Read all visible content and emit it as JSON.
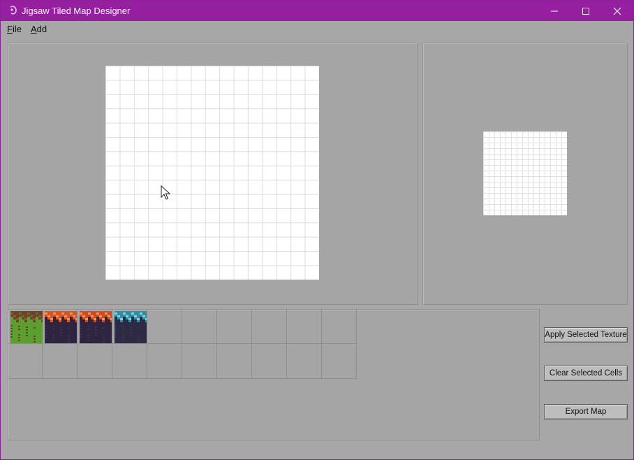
{
  "window": {
    "title": "Jigsaw Tiled Map Designer",
    "controls": {
      "minimize": "—",
      "maximize": "☐",
      "close": "✕"
    }
  },
  "menu": {
    "file": {
      "mnemonic": "F",
      "rest": "ile"
    },
    "add": {
      "mnemonic": "A",
      "rest": "dd"
    }
  },
  "map_editor": {
    "rows": 15,
    "cols": 15
  },
  "preview": {
    "rows": 15,
    "cols": 15
  },
  "texture_palette": {
    "rows": 2,
    "cols": 10,
    "textures": [
      {
        "name": "grass-dirt-texture",
        "colors": [
          "#5aa02e",
          "#8a5a32",
          "#6b4424"
        ]
      },
      {
        "name": "lava-rock-texture",
        "colors": [
          "#2f2440",
          "#d6542a",
          "#e89a3a"
        ]
      },
      {
        "name": "magma-rock-texture",
        "colors": [
          "#2e2440",
          "#cf4a26",
          "#f0a040"
        ]
      },
      {
        "name": "ice-rock-texture",
        "colors": [
          "#2e2a44",
          "#2f8ea2",
          "#7fd6d8"
        ]
      }
    ]
  },
  "buttons": {
    "apply": "Apply Selected Texture",
    "clear": "Clear Selected Cells",
    "export": "Export Map"
  }
}
